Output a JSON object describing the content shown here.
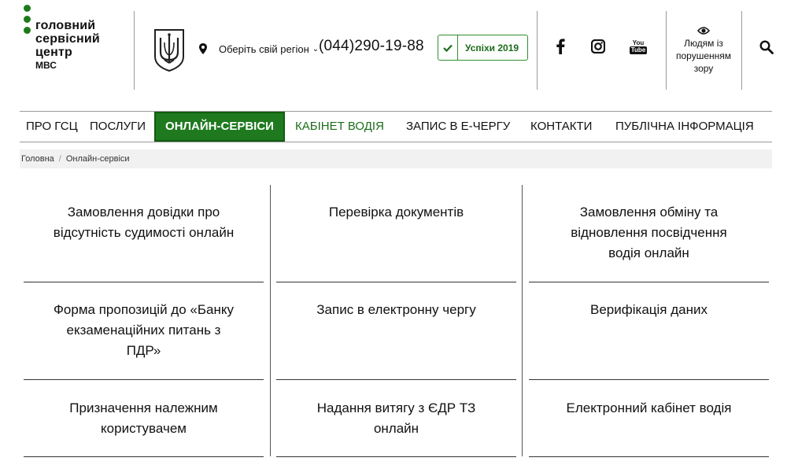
{
  "header": {
    "logo": {
      "line1": "головний",
      "line2": "сервісний",
      "line3": "центр",
      "sub": "МВС"
    },
    "emblem_icon": "trident-coat-of-arms",
    "region": {
      "icon": "location-pin-icon",
      "label": "Оберіть свій регіон",
      "chevron": "⌄"
    },
    "phone": "(044)290-19-88",
    "success_button": {
      "icon": "check-icon",
      "label": "Успіхи 2019"
    },
    "social": [
      {
        "name": "facebook",
        "icon": "facebook-icon"
      },
      {
        "name": "instagram",
        "icon": "instagram-icon"
      },
      {
        "name": "youtube",
        "icon": "youtube-icon",
        "label_top": "You",
        "label_bottom": "Tube"
      }
    ],
    "vision": {
      "icon": "eye-icon",
      "label": "Людям із порушенням зору"
    },
    "search_icon": "search-icon"
  },
  "nav": {
    "items": [
      {
        "label": "ПРО ГСЦ"
      },
      {
        "label": "ПОСЛУГИ"
      },
      {
        "label": "ОНЛАЙН-СЕРВІСИ",
        "active": true
      },
      {
        "label": "КАБІНЕТ ВОДІЯ",
        "highlight": true
      },
      {
        "label": "ЗАПИС В Е-ЧЕРГУ"
      },
      {
        "label": "КОНТАКТИ"
      },
      {
        "label": "ПУБЛІЧНА ІНФОРМАЦІЯ"
      }
    ]
  },
  "breadcrumb": {
    "home": "Головна",
    "separator": "/",
    "current": "Онлайн-сервіси"
  },
  "services": [
    {
      "lines": [
        "Замовлення довідки про",
        "відсутність судимості онлайн"
      ]
    },
    {
      "lines": [
        "Перевірка документів"
      ]
    },
    {
      "lines": [
        "Замовлення обміну та",
        "відновлення посвідчення",
        "водія онлайн"
      ]
    },
    {
      "lines": [
        "Форма пропозицій до «Банку",
        "екзаменаційних питань з",
        "ПДР»"
      ]
    },
    {
      "lines": [
        "Запис в електронну чергу"
      ]
    },
    {
      "lines": [
        "Верифікація даних"
      ]
    },
    {
      "lines": [
        "Призначення належним",
        "користувачем"
      ]
    },
    {
      "lines": [
        "Надання витягу з ЄДР ТЗ",
        "онлайн"
      ]
    },
    {
      "lines": [
        "Електронний кабінет водія"
      ]
    }
  ],
  "colors": {
    "brand_green": "#1f7a1f",
    "accent_green": "#2f8f2f",
    "text": "#111111",
    "divider": "#9a9a9a"
  }
}
